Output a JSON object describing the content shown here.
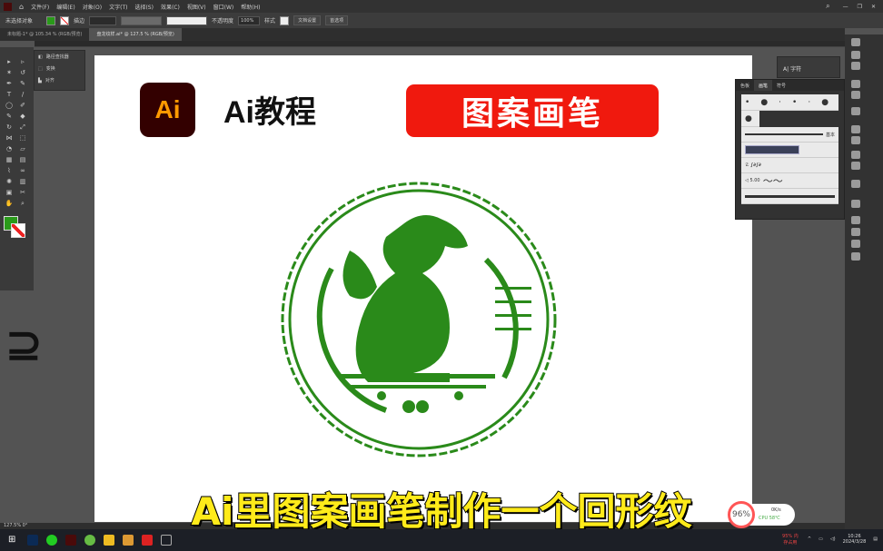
{
  "menu": [
    "文件(F)",
    "编辑(E)",
    "对象(O)",
    "文字(T)",
    "选择(S)",
    "效果(C)",
    "视图(V)",
    "窗口(W)",
    "帮助(H)"
  ],
  "control": {
    "selection": "未选择对象",
    "stroke_label": "描边",
    "opacity_label": "不透明度",
    "opacity": "100%",
    "style_label": "样式",
    "doc_settings": "文档设置",
    "preferences": "首选项",
    "fill_color": "#2a9a1a"
  },
  "tabs": [
    {
      "label": "未标题-1* @ 105.34 % (RGB/预览)"
    },
    {
      "label": "盘龙纹样.ai* @ 127.5 % (RGB/预览)",
      "active": true
    }
  ],
  "flyout": [
    "路径查找器",
    "变换",
    "对齐"
  ],
  "artboard": {
    "logo": "Ai",
    "title": "Ai教程",
    "banner": "图案画笔",
    "dragon_color": "#2a8a1a"
  },
  "brush_panel": {
    "tabs": [
      "色板",
      "画笔",
      "符号"
    ],
    "active": "画笔",
    "basic": "基本",
    "brush_value": "5.00"
  },
  "char_panel": {
    "label": "字符"
  },
  "subtitle": "Ai里图案画笔制作一个回形纹",
  "status": {
    "zoom": "127.5%",
    "angle": "0°"
  },
  "meter": {
    "percent": "96%",
    "speed": "0K/s",
    "cpu": "CPU 58℃"
  },
  "tray": {
    "mem": "95% 内存占用",
    "time": "10:26",
    "date": "2024/3/28"
  }
}
